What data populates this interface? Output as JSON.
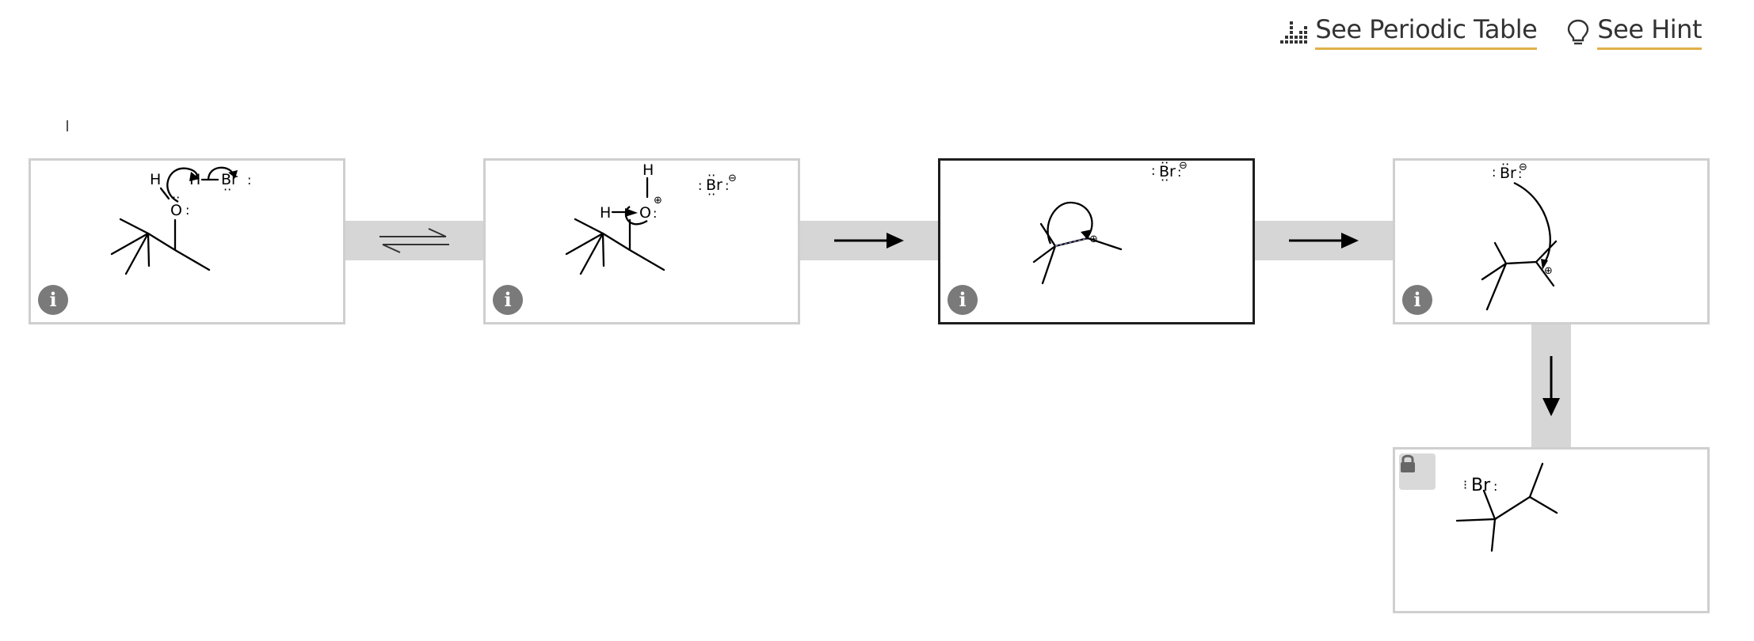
{
  "header": {
    "periodic_table_label": "See Periodic Table",
    "hint_label": "See Hint"
  },
  "mechanism": {
    "steps": [
      {
        "id": 1,
        "atoms": {
          "h_left": "H",
          "h_mid": "H",
          "br": "Br",
          "o": "O"
        }
      },
      {
        "id": 2,
        "atoms": {
          "h_top": "H",
          "h_left": "H",
          "o": "O",
          "charge_o": "⊕",
          "br": "Br",
          "charge_br": "⊖"
        }
      },
      {
        "id": 3,
        "selected": true,
        "atoms": {
          "br": "Br",
          "charge_br": "⊖",
          "charge_c": "⊕"
        }
      },
      {
        "id": 4,
        "atoms": {
          "br": "Br",
          "charge_br": "⊖",
          "charge_c": "⊕"
        }
      },
      {
        "id": 5,
        "locked": true,
        "atoms": {
          "br": "Br"
        }
      }
    ],
    "connectors": [
      "equilibrium",
      "forward",
      "forward",
      "down"
    ]
  },
  "icons": {
    "periodic": "periodic-table-icon",
    "hint": "lightbulb-icon",
    "info": "info-icon",
    "lock": "lock-icon"
  },
  "colors": {
    "hint_underline": "#e0b04a",
    "frame_border": "#cfcfcf",
    "connector": "#d6d6d6"
  }
}
